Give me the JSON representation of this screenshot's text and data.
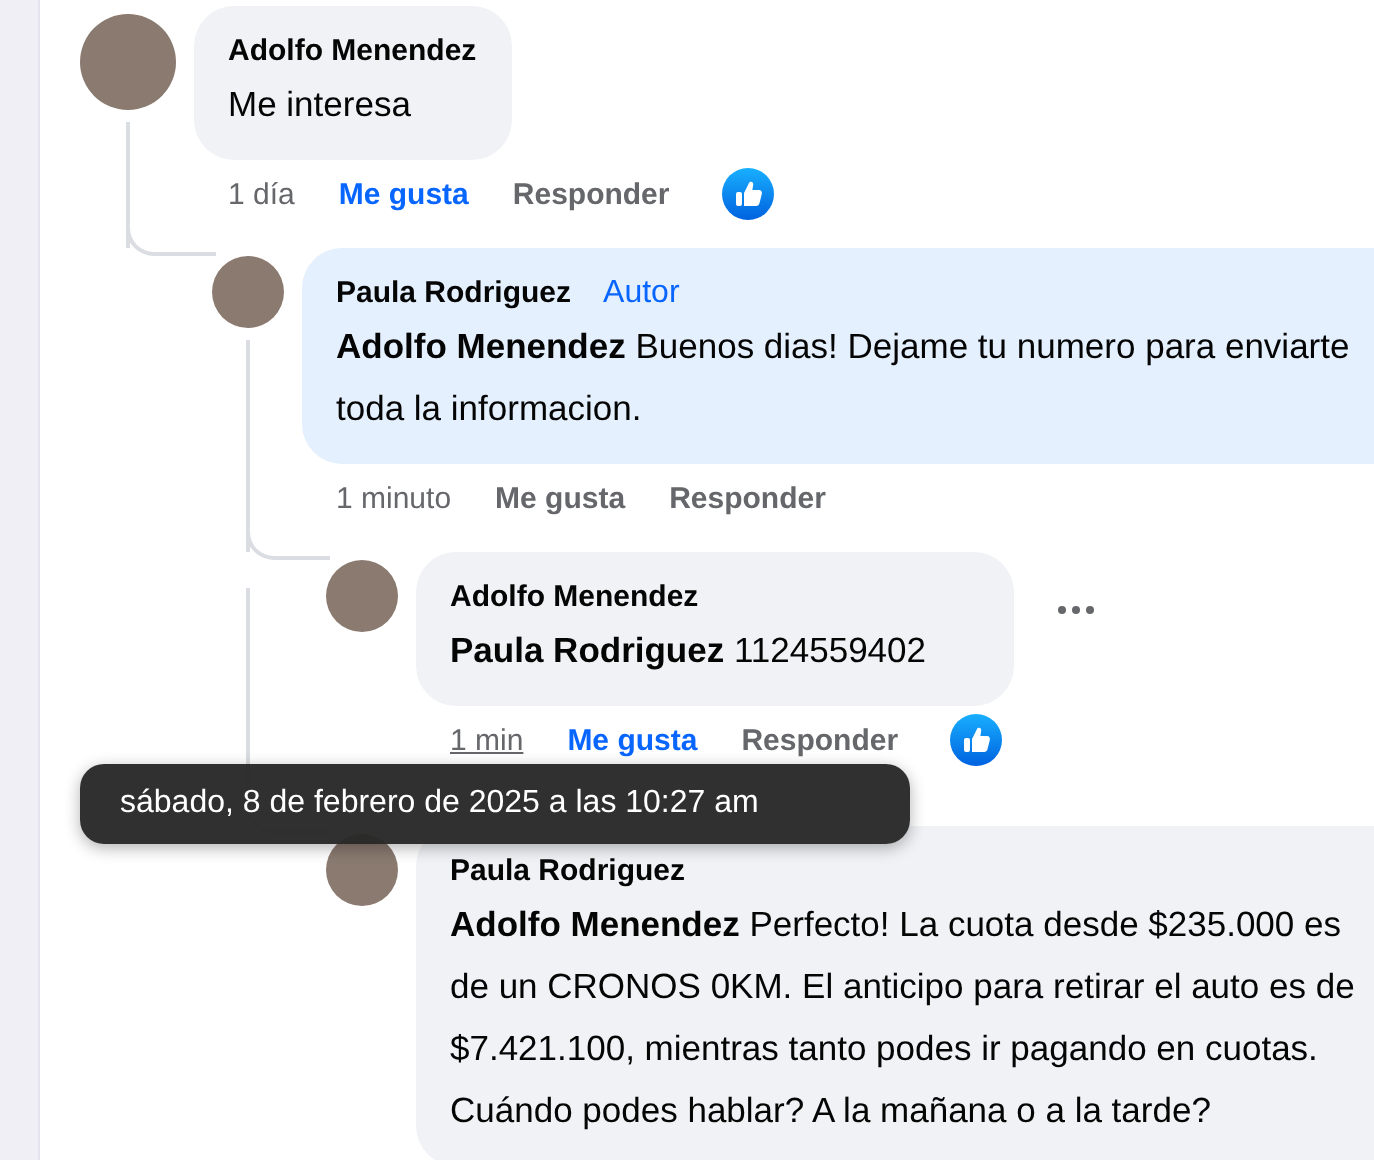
{
  "comments": [
    {
      "author": "Adolfo Menendez",
      "text": "Me interesa",
      "highlighted": false,
      "time": "1 día",
      "like": "Me gusta",
      "liked": true,
      "reply": "Responder",
      "reaction_icon": true,
      "replies": [
        {
          "author": "Paula Rodriguez",
          "badge": "Autor",
          "text": "**Adolfo Menendez** Buenos dias! Dejame tu numero para enviarte toda la informacion.",
          "highlighted": true,
          "time": "1 minuto",
          "like": "Me gusta",
          "liked": false,
          "reply": "Responder",
          "replies": [
            {
              "author": "Adolfo Menendez",
              "text": "**Paula Rodriguez** 1124559402",
              "highlighted": false,
              "time": "1 min",
              "time_tooltip": "sábado, 8 de febrero de 2025 a las 10:27 am",
              "like": "Me gusta",
              "liked": true,
              "reply": "Responder",
              "reaction_icon": true,
              "more_menu": true
            },
            {
              "author": "Paula Rodriguez",
              "text": "**Adolfo Menendez** Perfecto! La cuota desde $235.000 es de un CRONOS 0KM. El anticipo para retirar el auto es de $7.421.100, mientras tanto podes ir pagando en cuotas. Cuándo podes hablar? A la mañana o a la tarde?",
              "highlighted": false
            }
          ]
        }
      ]
    }
  ]
}
